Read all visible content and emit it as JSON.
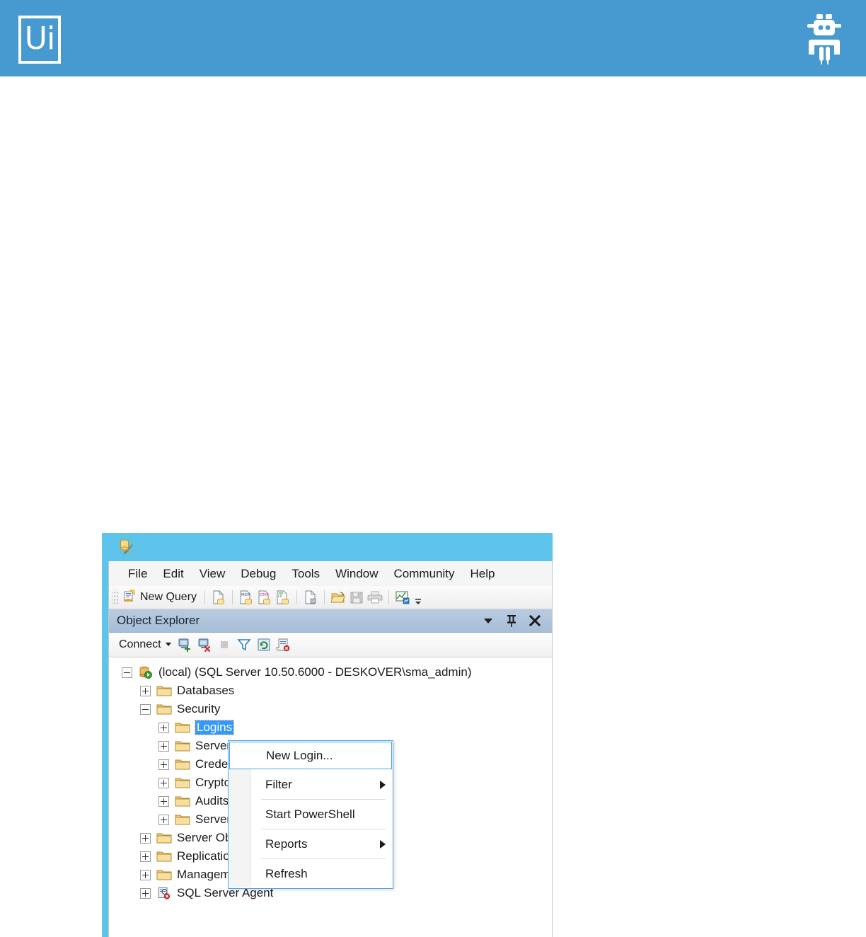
{
  "brand": {
    "logo_text": "Ui",
    "logo_name": "uipath-logo",
    "robot_icon": "robot-icon",
    "band_color": "#469ad0"
  },
  "window": {
    "app_icon": "ssms-database-tools-icon",
    "title": "",
    "titlebar_color": "#5fc4ec",
    "accent_color": "#5fc4ec"
  },
  "menubar": {
    "items": [
      {
        "label": "File",
        "name": "menu-file"
      },
      {
        "label": "Edit",
        "name": "menu-edit"
      },
      {
        "label": "View",
        "name": "menu-view"
      },
      {
        "label": "Debug",
        "name": "menu-debug"
      },
      {
        "label": "Tools",
        "name": "menu-tools"
      },
      {
        "label": "Window",
        "name": "menu-window"
      },
      {
        "label": "Community",
        "name": "menu-community"
      },
      {
        "label": "Help",
        "name": "menu-help"
      }
    ]
  },
  "toolbar": {
    "new_query_label": "New Query",
    "buttons": [
      {
        "name": "new-query-icon"
      },
      {
        "name": "database-engine-query-icon"
      },
      {
        "name": "mdx-query-icon"
      },
      {
        "name": "dmx-query-icon"
      },
      {
        "name": "xmla-query-icon"
      },
      {
        "name": "analysis-services-query-icon"
      },
      {
        "name": "open-file-icon"
      },
      {
        "name": "save-icon"
      },
      {
        "name": "print-icon"
      },
      {
        "name": "activity-monitor-icon"
      }
    ],
    "overflow_name": "toolbar-overflow-chevron-icon"
  },
  "object_explorer": {
    "title": "Object Explorer",
    "header_buttons": [
      {
        "name": "window-position-dropdown-icon"
      },
      {
        "name": "auto-hide-pin-icon"
      },
      {
        "name": "close-icon"
      }
    ],
    "toolbar": {
      "connect_label": "Connect",
      "connect_dropdown_name": "connect-dropdown-chevron-icon",
      "buttons": [
        {
          "name": "connect-object-explorer-icon"
        },
        {
          "name": "disconnect-object-explorer-icon"
        },
        {
          "name": "stop-icon"
        },
        {
          "name": "filter-icon"
        },
        {
          "name": "refresh-icon"
        },
        {
          "name": "script-icon"
        }
      ]
    },
    "tree": [
      {
        "label": "(local) (SQL Server 10.50.6000 - DESKOVER\\sma_admin)",
        "name": "tree-node-server",
        "icon": "server-connected-icon",
        "indent": 0,
        "state": "collapse",
        "selected": false
      },
      {
        "label": "Databases",
        "name": "tree-node-databases",
        "icon": "folder-icon",
        "indent": 1,
        "state": "expand",
        "selected": false
      },
      {
        "label": "Security",
        "name": "tree-node-security",
        "icon": "folder-icon",
        "indent": 1,
        "state": "collapse",
        "selected": false
      },
      {
        "label": "Logins",
        "name": "tree-node-logins",
        "icon": "folder-icon",
        "indent": 2,
        "state": "expand",
        "selected": true
      },
      {
        "label": "Server Roles",
        "name": "tree-node-server-roles",
        "icon": "folder-icon",
        "indent": 2,
        "state": "expand",
        "selected": false
      },
      {
        "label": "Credentials",
        "name": "tree-node-credentials",
        "icon": "folder-icon",
        "indent": 2,
        "state": "expand",
        "selected": false
      },
      {
        "label": "Cryptographic Providers",
        "name": "tree-node-cryptographic-providers",
        "icon": "folder-icon",
        "indent": 2,
        "state": "expand",
        "selected": false
      },
      {
        "label": "Audits",
        "name": "tree-node-audits",
        "icon": "folder-icon",
        "indent": 2,
        "state": "expand",
        "selected": false
      },
      {
        "label": "Server Audit Specifications",
        "name": "tree-node-server-audit-specifications",
        "icon": "folder-icon",
        "indent": 2,
        "state": "expand",
        "selected": false
      },
      {
        "label": "Server Objects",
        "name": "tree-node-server-objects",
        "icon": "folder-icon",
        "indent": 1,
        "state": "expand",
        "selected": false
      },
      {
        "label": "Replication",
        "name": "tree-node-replication",
        "icon": "folder-icon",
        "indent": 1,
        "state": "expand",
        "selected": false
      },
      {
        "label": "Management",
        "name": "tree-node-management",
        "icon": "folder-icon",
        "indent": 1,
        "state": "expand",
        "selected": false
      },
      {
        "label": "SQL Server Agent",
        "name": "tree-node-sql-server-agent",
        "icon": "sql-agent-stopped-icon",
        "indent": 1,
        "state": "expand",
        "selected": false
      }
    ]
  },
  "context_menu": {
    "items": [
      {
        "label": "New Login...",
        "name": "context-menu-new-login",
        "highlighted": true,
        "submenu": false
      },
      {
        "label": "Filter",
        "name": "context-menu-filter",
        "highlighted": false,
        "submenu": true
      },
      {
        "label": "Start PowerShell",
        "name": "context-menu-start-powershell",
        "highlighted": false,
        "submenu": false
      },
      {
        "label": "Reports",
        "name": "context-menu-reports",
        "highlighted": false,
        "submenu": true
      },
      {
        "label": "Refresh",
        "name": "context-menu-refresh",
        "highlighted": false,
        "submenu": false
      }
    ],
    "separators_after": [
      1,
      2,
      3
    ],
    "highlight_color": "#4aa3e8"
  }
}
